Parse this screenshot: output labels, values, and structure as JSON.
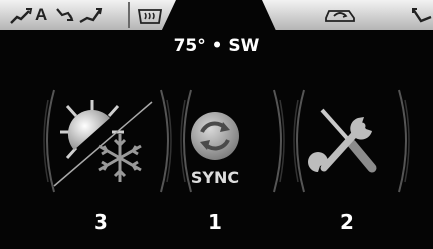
{
  "status_bar": {
    "left_icons": [
      "fan-to-windshield-icon",
      "auto-climate-icon",
      "fan-to-floor-icon",
      "defrost-icon"
    ],
    "auto_label": "A",
    "right_icons": [
      "recirculation-icon",
      "fan-to-face-icon"
    ]
  },
  "readout": "75° • SW",
  "menu": {
    "items": [
      {
        "icon": "climate-sun-snowflake-icon",
        "number": "3"
      },
      {
        "icon": "sync-icon",
        "label": "SYNC",
        "number": "1"
      },
      {
        "icon": "settings-tools-icon",
        "number": "2"
      }
    ]
  },
  "colors": {
    "background": "#000000",
    "tab": "#d8d8d8",
    "text": "#ffffff"
  }
}
